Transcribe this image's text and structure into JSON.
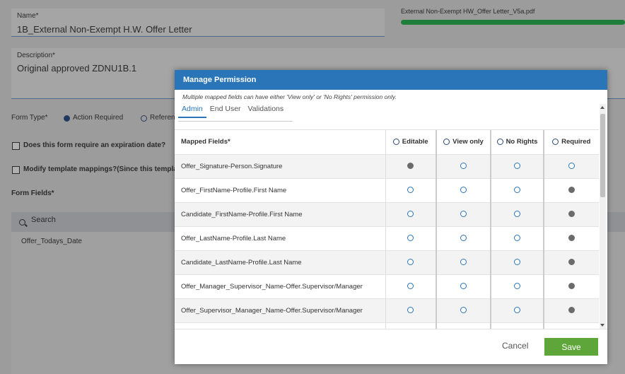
{
  "background_form": {
    "name_label": "Name*",
    "name_value": "1B_External Non-Exempt H.W. Offer Letter",
    "pdf_filename": "External Non-Exempt HW_Offer Letter_V5a.pdf",
    "upload_progress": 1.0,
    "description_label": "Description*",
    "description_value": "Original approved ZDNU1B.1",
    "form_type_label": "Form Type*",
    "form_type_option_1": "Action Required",
    "form_type_option_2": "Referen",
    "expiration_question": "Does this form require an expiration date?",
    "modify_mappings_label": "Modify template mappings?(Since this template i",
    "form_fields_label": "Form Fields*",
    "search_placeholder": "Search",
    "list_first_item": "Offer_Todays_Date"
  },
  "modal": {
    "title": "Manage Permission",
    "note": "Multiple mapped fields can have either 'View only' or 'No Rights' permission only.",
    "tabs": [
      {
        "label": "Admin",
        "active": true
      },
      {
        "label": "End User",
        "active": false
      },
      {
        "label": "Validations",
        "active": false
      }
    ],
    "columns": {
      "mapped_fields": "Mapped Fields*",
      "editable": "Editable",
      "view_only": "View only",
      "no_rights": "No Rights",
      "required": "Required"
    },
    "rows": [
      {
        "field": "Offer_Signature-Person.Signature",
        "selected": "editable"
      },
      {
        "field": "Offer_FirstName-Profile.First Name",
        "selected": "required"
      },
      {
        "field": "Candidate_FirstName-Profile.First Name",
        "selected": "required"
      },
      {
        "field": "Offer_LastName-Profile.Last Name",
        "selected": "required"
      },
      {
        "field": "Candidate_LastName-Profile.Last Name",
        "selected": "required"
      },
      {
        "field": "Offer_Manager_Supervisor_Name-Offer.Supervisor/Manager",
        "selected": "required"
      },
      {
        "field": "Offer_Supervisor_Manager_Name-Offer.Supervisor/Manager",
        "selected": "required"
      },
      {
        "field": "",
        "selected": ""
      }
    ],
    "cancel_label": "Cancel",
    "save_label": "Save"
  },
  "colors": {
    "header_blue": "#2a74b8",
    "save_green": "#5fa63a",
    "progress_green": "#1e7e3a"
  }
}
